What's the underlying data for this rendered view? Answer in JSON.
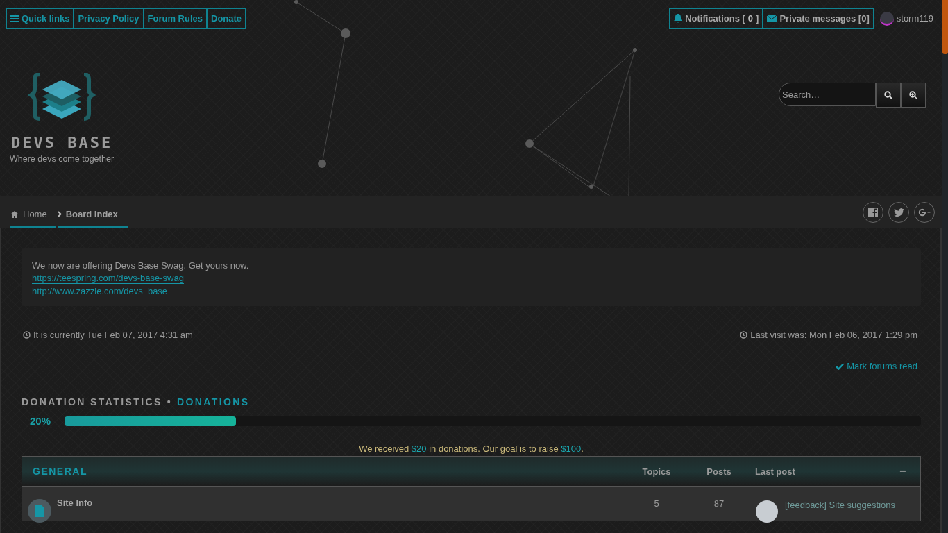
{
  "top_nav": {
    "links": [
      {
        "label": "Quick links"
      },
      {
        "label": "Privacy Policy"
      },
      {
        "label": "Forum Rules"
      },
      {
        "label": "Donate"
      }
    ],
    "notifications": {
      "label": "Notifications [",
      "count": "0",
      "end": "]"
    },
    "messages": {
      "label": "Private messages [0]"
    },
    "user": {
      "name": "storm119"
    }
  },
  "site": {
    "name": "DEVS BASE",
    "tagline": "Where devs come together"
  },
  "search": {
    "placeholder": "Search…"
  },
  "breadcrumbs": [
    {
      "label": "Home"
    },
    {
      "label": "Board index"
    }
  ],
  "notice": {
    "text": "We now are offering Devs Base Swag. Get yours now.",
    "links": [
      "https://teespring.com/devs-base-swag",
      "http://www.zazzle.com/devs_base"
    ]
  },
  "current_time": "It is currently Tue Feb 07, 2017 4:31 am",
  "last_visit": "Last visit was: Mon Feb 06, 2017 1:29 pm",
  "mark_read": "Mark forums read",
  "donation": {
    "title": "DONATION STATISTICS",
    "separator": "•",
    "link": "DONATIONS",
    "percent": "20%",
    "level": 0.2,
    "message": [
      {
        "kind": "text",
        "text": "We received "
      },
      {
        "kind": "amount",
        "text": "$20"
      },
      {
        "kind": "text",
        "text": " in donations. Our goal is to raise "
      },
      {
        "kind": "amount",
        "text": "$100"
      },
      {
        "kind": "text",
        "text": "."
      }
    ]
  },
  "forum": {
    "category": "GENERAL",
    "columns": [
      "Topics",
      "Posts",
      "Last post"
    ],
    "collapse": "−",
    "rows": [
      {
        "name": "Site Info",
        "topics": "5",
        "posts": "87",
        "last_post": "[feedback] Site suggestions"
      }
    ]
  }
}
